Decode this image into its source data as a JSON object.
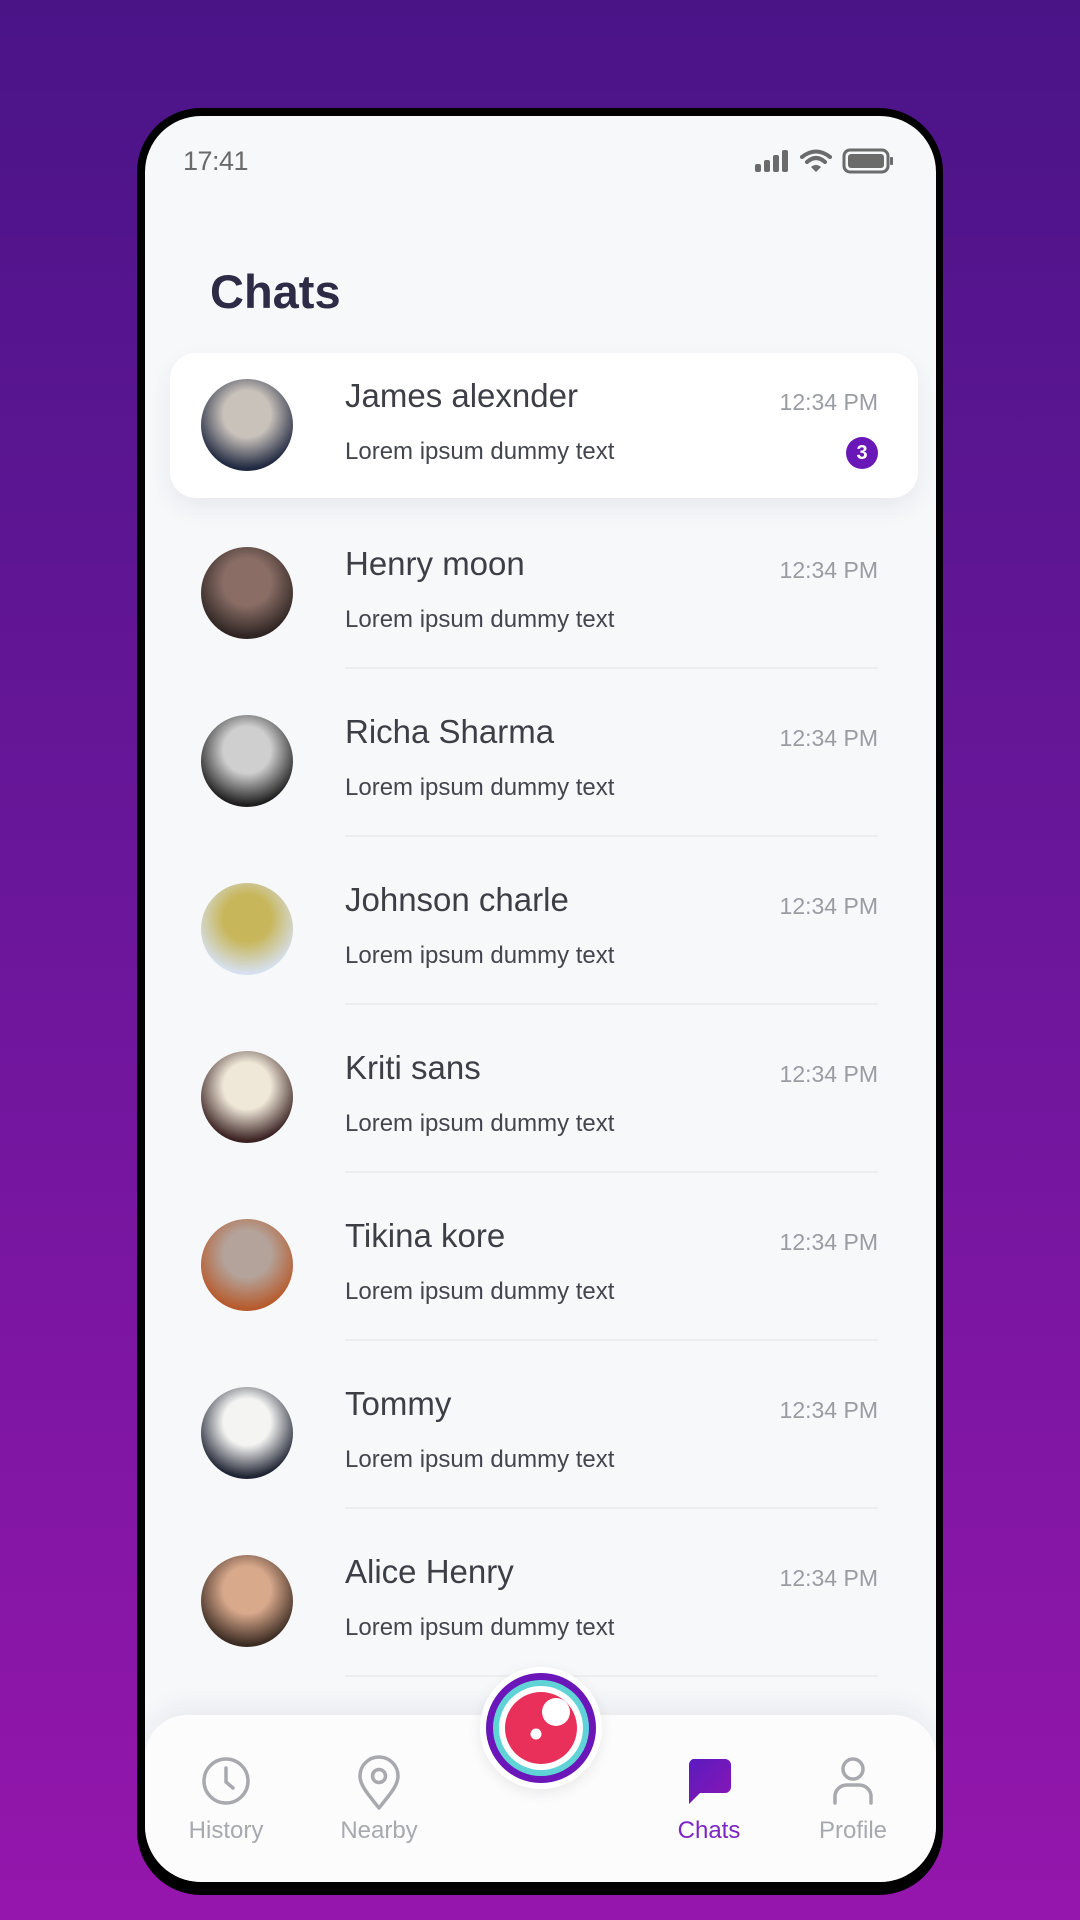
{
  "status_bar": {
    "time": "17:41",
    "icons": [
      "signal-icon",
      "wifi-icon",
      "battery-icon"
    ]
  },
  "header": {
    "title": "Chats"
  },
  "chats": [
    {
      "name": "James alexnder",
      "preview": "Lorem ipsum dummy text",
      "time": "12:34 PM",
      "unread": "3",
      "active": true,
      "avatar_colors": [
        "#c9c2bb",
        "#1f2840"
      ]
    },
    {
      "name": "Henry moon",
      "preview": "Lorem ipsum dummy text",
      "time": "12:34 PM",
      "unread": null,
      "active": false,
      "avatar_colors": [
        "#8a6e66",
        "#2e2422"
      ]
    },
    {
      "name": "Richa Sharma",
      "preview": "Lorem ipsum dummy text",
      "time": "12:34 PM",
      "unread": null,
      "active": false,
      "avatar_colors": [
        "#cfcfcf",
        "#1e1e1e"
      ]
    },
    {
      "name": "Johnson charle",
      "preview": "Lorem ipsum dummy text",
      "time": "12:34 PM",
      "unread": null,
      "active": false,
      "avatar_colors": [
        "#c8b65a",
        "#d6e0ee"
      ]
    },
    {
      "name": "Kriti sans",
      "preview": "Lorem ipsum dummy text",
      "time": "12:34 PM",
      "unread": null,
      "active": false,
      "avatar_colors": [
        "#efe7d8",
        "#3a2222"
      ]
    },
    {
      "name": "Tikina kore",
      "preview": "Lorem ipsum dummy text",
      "time": "12:34 PM",
      "unread": null,
      "active": false,
      "avatar_colors": [
        "#b4a39a",
        "#b65a2c"
      ]
    },
    {
      "name": "Tommy",
      "preview": "Lorem ipsum dummy text",
      "time": "12:34 PM",
      "unread": null,
      "active": false,
      "avatar_colors": [
        "#f4f4f2",
        "#1f2433"
      ]
    },
    {
      "name": "Alice Henry",
      "preview": "Lorem ipsum dummy text",
      "time": "12:34 PM",
      "unread": null,
      "active": false,
      "avatar_colors": [
        "#d9a98c",
        "#3b2b22"
      ]
    }
  ],
  "bottom_nav": {
    "items": [
      {
        "label": "History",
        "icon": "clock-icon",
        "active": false
      },
      {
        "label": "Nearby",
        "icon": "location-pin-icon",
        "active": false
      },
      {
        "label": "Chats",
        "icon": "chat-bubble-icon",
        "active": true
      },
      {
        "label": "Profile",
        "icon": "user-icon",
        "active": false
      }
    ],
    "center_button": {
      "icon": "camera-lens-icon"
    }
  },
  "colors": {
    "accent": "#6a17b8",
    "background_top": "#4a1487",
    "background_bottom": "#9516ac",
    "camera_ring_outer": "#6a16b8",
    "camera_ring_inner": "#5fd3d6",
    "camera_lens": "#e8305a",
    "inactive_nav": "#a7a9ae"
  }
}
